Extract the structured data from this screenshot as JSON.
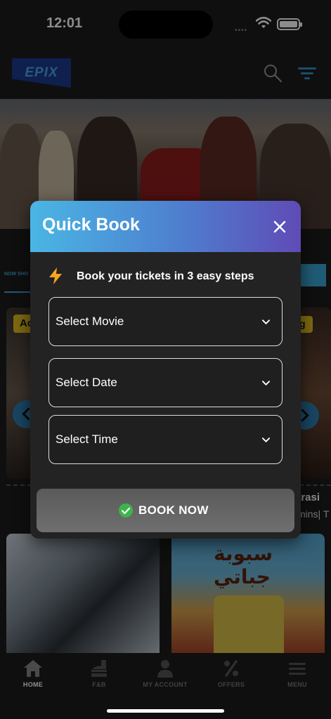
{
  "status_bar": {
    "time": "12:01",
    "signal": "••••"
  },
  "header": {
    "logo_text": "EPIX"
  },
  "tabs": {
    "now_showing": "NOW SHO"
  },
  "carousel": {
    "left_tag": "Ac",
    "right_tag": "g",
    "right_title": "arasi",
    "right_meta": "mins| T"
  },
  "poster_arabic": "سبوبة جباتي",
  "bottom_nav": {
    "items": [
      {
        "label": "HOME",
        "icon": "home-icon",
        "active": true
      },
      {
        "label": "F&B",
        "icon": "food-beverage-icon",
        "active": false
      },
      {
        "label": "MY ACCOUNT",
        "icon": "account-icon",
        "active": false
      },
      {
        "label": "OFFERS",
        "icon": "offers-icon",
        "active": false
      },
      {
        "label": "MENU",
        "icon": "menu-icon",
        "active": false
      }
    ]
  },
  "modal": {
    "title": "Quick Book",
    "intro": "Book your tickets in 3 easy steps",
    "select_movie": "Select Movie",
    "select_date": "Select Date",
    "select_time": "Select Time",
    "book_button": "BOOK NOW"
  },
  "colors": {
    "accent": "#3ba6d8",
    "modal_header_start": "#4ab6e4",
    "modal_header_end": "#5f4bb6",
    "bolt": "#f5a623",
    "check": "#3cb54a",
    "tag": "#e6c020"
  }
}
